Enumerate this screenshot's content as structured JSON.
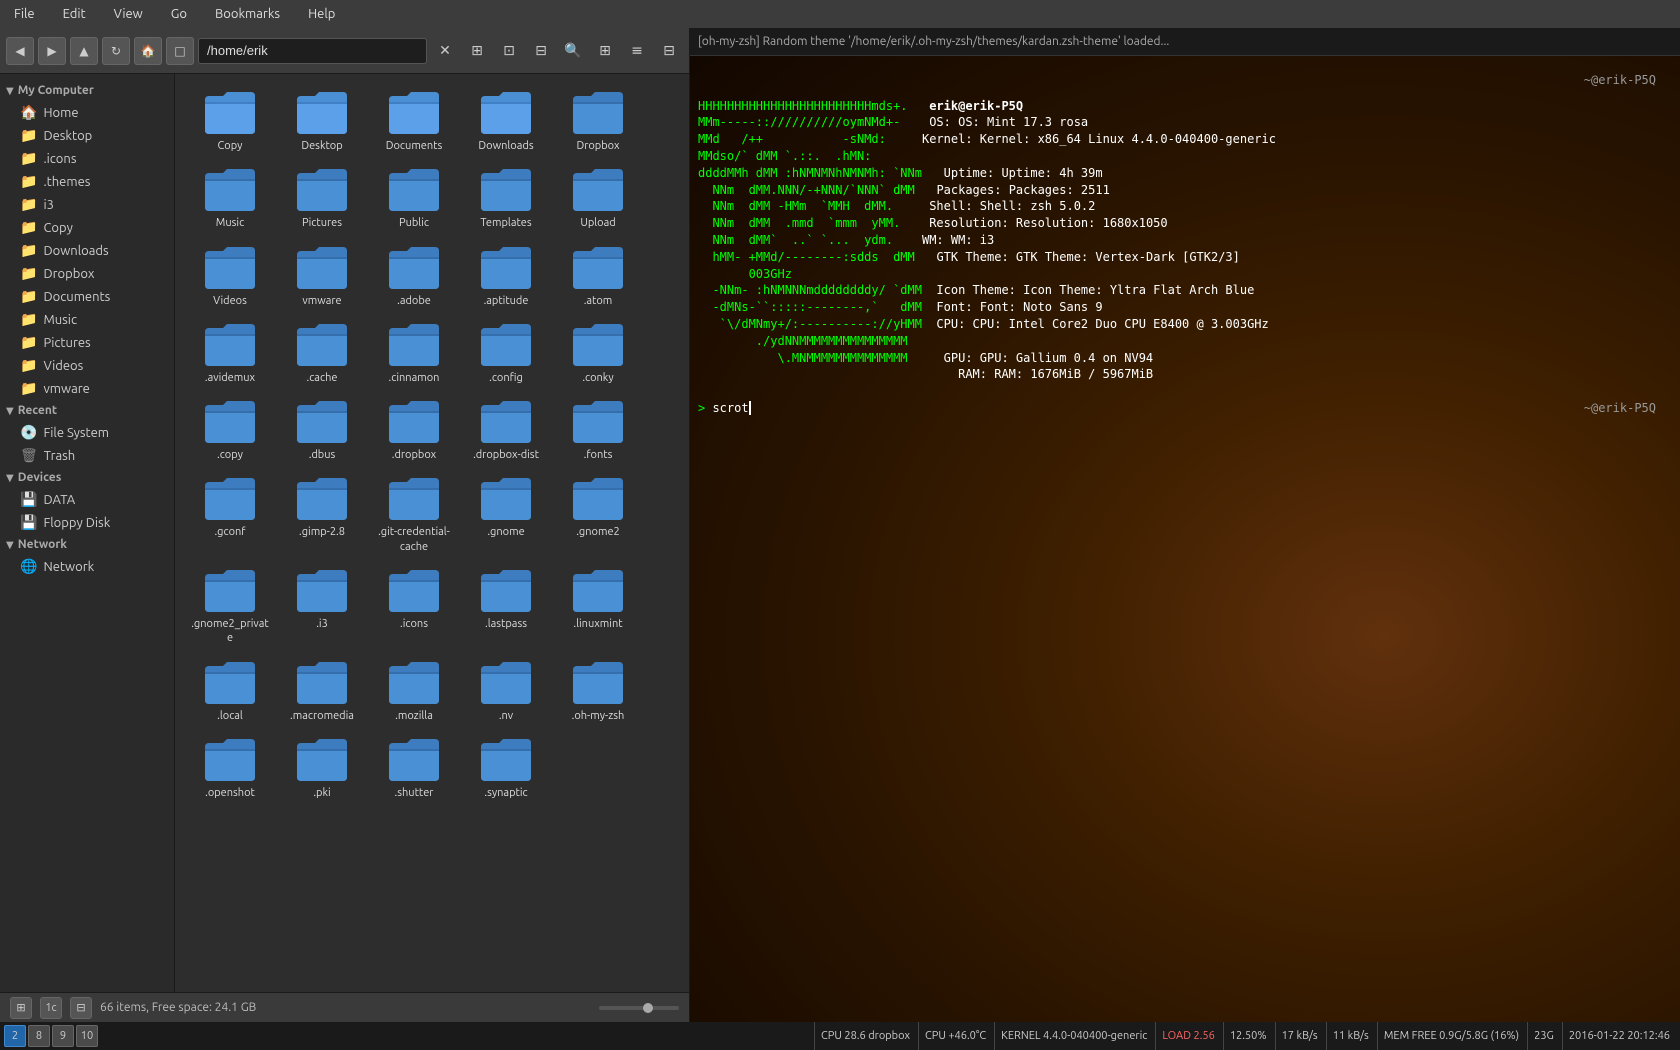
{
  "menubar": {
    "items": [
      "File",
      "Edit",
      "View",
      "Go",
      "Bookmarks",
      "Help"
    ]
  },
  "toolbar": {
    "back_label": "◀",
    "forward_label": "▶",
    "up_label": "▲",
    "reload_label": "↻",
    "home_label": "🏠",
    "new_tab_label": "□",
    "address": "/home/erik",
    "close_label": "✕",
    "toggle1_label": "⊞",
    "toggle2_label": "≡",
    "toggle3_label": "⊟",
    "search_label": "🔍",
    "view1_label": "⊞",
    "view2_label": "≡",
    "view3_label": "⊟"
  },
  "sidebar": {
    "my_computer_label": "My Computer",
    "items_computer": [
      {
        "label": "Home",
        "icon": "home"
      },
      {
        "label": "Desktop",
        "icon": "folder"
      },
      {
        "label": ".icons",
        "icon": "folder"
      },
      {
        "label": ".themes",
        "icon": "folder"
      },
      {
        "label": "i3",
        "icon": "folder"
      },
      {
        "label": "Copy",
        "icon": "folder"
      },
      {
        "label": "Downloads",
        "icon": "folder"
      },
      {
        "label": "Dropbox",
        "icon": "folder"
      },
      {
        "label": "Documents",
        "icon": "folder"
      },
      {
        "label": "Music",
        "icon": "folder"
      },
      {
        "label": "Pictures",
        "icon": "folder"
      },
      {
        "label": "Videos",
        "icon": "folder"
      },
      {
        "label": "vmware",
        "icon": "folder"
      }
    ],
    "recent_label": "Recent",
    "items_recent": [
      {
        "label": "File System",
        "icon": "filesystem"
      },
      {
        "label": "Trash",
        "icon": "trash"
      }
    ],
    "devices_label": "Devices",
    "items_devices": [
      {
        "label": "DATA",
        "icon": "drive"
      },
      {
        "label": "Floppy Disk",
        "icon": "floppy"
      }
    ],
    "network_label": "Network",
    "items_network": [
      {
        "label": "Network",
        "icon": "network"
      }
    ]
  },
  "files": [
    {
      "name": "Copy",
      "type": "folder",
      "special": true
    },
    {
      "name": "Desktop",
      "type": "folder",
      "special": true
    },
    {
      "name": "Documents",
      "type": "folder",
      "special": true
    },
    {
      "name": "Downloads",
      "type": "folder",
      "special": true
    },
    {
      "name": "Dropbox",
      "type": "folder",
      "special": false
    },
    {
      "name": "Music",
      "type": "folder",
      "special": false
    },
    {
      "name": "Pictures",
      "type": "folder",
      "special": false
    },
    {
      "name": "Public",
      "type": "folder",
      "special": false
    },
    {
      "name": "Templates",
      "type": "folder",
      "special": false
    },
    {
      "name": "Upload",
      "type": "folder",
      "special": false
    },
    {
      "name": "Videos",
      "type": "folder",
      "special": false
    },
    {
      "name": "vmware",
      "type": "folder",
      "special": false
    },
    {
      "name": ".adobe",
      "type": "folder",
      "special": false
    },
    {
      "name": ".aptitude",
      "type": "folder",
      "special": false
    },
    {
      "name": ".atom",
      "type": "folder",
      "special": false
    },
    {
      "name": ".avidemux",
      "type": "folder",
      "special": false
    },
    {
      "name": ".cache",
      "type": "folder",
      "special": false
    },
    {
      "name": ".cinnamon",
      "type": "folder",
      "special": false
    },
    {
      "name": ".config",
      "type": "folder",
      "special": false
    },
    {
      "name": ".conky",
      "type": "folder",
      "special": false
    },
    {
      "name": ".copy",
      "type": "folder",
      "special": false
    },
    {
      "name": ".dbus",
      "type": "folder",
      "special": false
    },
    {
      "name": ".dropbox",
      "type": "folder",
      "special": false
    },
    {
      "name": ".dropbox-dist",
      "type": "folder",
      "special": false
    },
    {
      "name": ".fonts",
      "type": "folder",
      "special": false
    },
    {
      "name": ".gconf",
      "type": "folder",
      "special": false
    },
    {
      "name": ".gimp-2.8",
      "type": "folder",
      "special": false
    },
    {
      "name": ".git-credential-cache",
      "type": "folder",
      "special": false
    },
    {
      "name": ".gnome",
      "type": "folder",
      "special": false
    },
    {
      "name": ".gnome2",
      "type": "folder",
      "special": false
    },
    {
      "name": ".gnome2_private",
      "type": "folder",
      "special": false
    },
    {
      "name": ".i3",
      "type": "folder",
      "special": false
    },
    {
      "name": ".icons",
      "type": "folder",
      "special": false
    },
    {
      "name": ".lastpass",
      "type": "folder",
      "special": false
    },
    {
      "name": ".linuxmint",
      "type": "folder",
      "special": false
    },
    {
      "name": ".local",
      "type": "folder",
      "special": false
    },
    {
      "name": ".macromedia",
      "type": "folder",
      "special": false
    },
    {
      "name": ".mozilla",
      "type": "folder",
      "special": false
    },
    {
      "name": ".nv",
      "type": "folder",
      "special": false
    },
    {
      "name": ".oh-my-zsh",
      "type": "folder",
      "special": false
    },
    {
      "name": ".openshot",
      "type": "folder",
      "special": false
    },
    {
      "name": ".pki",
      "type": "folder",
      "special": false
    },
    {
      "name": ".shutter",
      "type": "folder",
      "special": false
    },
    {
      "name": ".synaptic",
      "type": "folder",
      "special": false
    }
  ],
  "statusbar": {
    "items_label": "66 items, Free space: 24.1 GB"
  },
  "terminal": {
    "title": "[oh-my-zsh] Random theme '/home/erik/.oh-my-zsh/themes/kardan.zsh-theme' loaded...",
    "user": "erik@erik-P5Q",
    "os": "OS: Mint 17.3 rosa",
    "kernel": "Kernel: x86_64 Linux 4.4.0-040400-generic",
    "uptime": "Uptime: 4h 39m",
    "packages": "Packages: 2511",
    "shell": "Shell: zsh 5.0.2",
    "resolution": "Resolution: 1680x1050",
    "wm": "WM: i3",
    "gtk_theme": "GTK Theme: Vertex-Dark [GTK2/3]",
    "icon_theme": "Icon Theme: Yltra Flat Arch Blue",
    "font": "Font: Noto Sans 9",
    "cpu": "CPU: Intel Core2 Duo CPU E8400 @ 3.003GHz",
    "gpu": "GPU: Gallium 0.4 on NV94",
    "ram": "RAM: 1676MiB / 5967MiB",
    "prompt": "> scrot",
    "prompt_loc": "~@erik-P5Q"
  },
  "taskbar": {
    "workspaces": [
      "2",
      "8",
      "9",
      "10"
    ],
    "active_workspace": "2",
    "cpu_label": "CPU 28.6 dropbox",
    "cpu_temp": "CPU +46.0°C",
    "kernel_label": "KERNEL 4.4.0-040400-generic",
    "load_label": "LOAD 2.56",
    "cpu_pct": "12.50%",
    "net_down": "17 kB/s",
    "net_up": "11 kB/s",
    "mem_label": "MEM FREE 0.9G/5.8G (16%)",
    "pct_23": "23G",
    "datetime": "2016-01-22 20:12:46"
  }
}
